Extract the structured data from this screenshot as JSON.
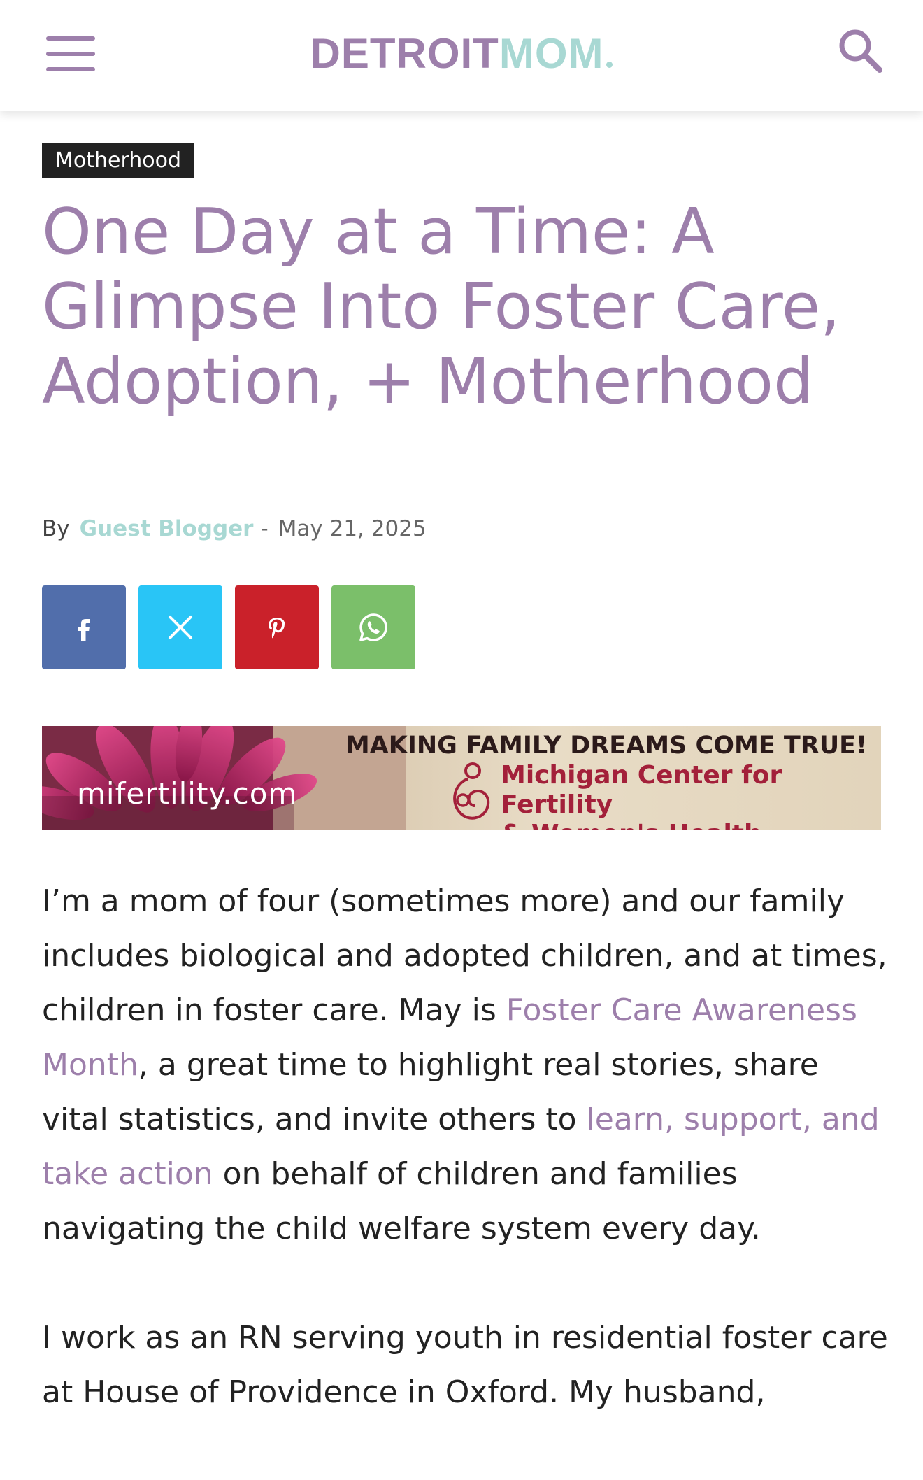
{
  "header": {
    "logo_part1": "DETROIT",
    "logo_part2": "MOM",
    "menu_icon": "hamburger-icon",
    "search_icon": "search-icon"
  },
  "article": {
    "category": "Motherhood",
    "title": "One Day at a Time: A Glimpse Into Foster Care, Adoption, + Motherhood",
    "by_label": "By",
    "author": "Guest Blogger",
    "separator": "-",
    "date": "May 21, 2025"
  },
  "share_buttons": [
    {
      "name": "facebook",
      "icon": "facebook-icon",
      "color": "#516eab"
    },
    {
      "name": "x",
      "icon": "x-icon",
      "color": "#29c5f6"
    },
    {
      "name": "pinterest",
      "icon": "pinterest-icon",
      "color": "#ca212a"
    },
    {
      "name": "whatsapp",
      "icon": "whatsapp-icon",
      "color": "#7bbf6a"
    }
  ],
  "ad_banner": {
    "url_text": "mifertility.com",
    "tagline": "MAKING FAMILY DREAMS COME TRUE!",
    "org_line1": "Michigan Center for Fertility",
    "org_line2": "& Women's Health"
  },
  "body": {
    "p1_a": "I’m a mom of four (sometimes more) and our family includes biological and adopted children, and at times, children in foster care. May is ",
    "p1_link1": "Foster Care Awareness Month",
    "p1_b": ", a great time to highlight real stories, share vital statistics, and invite others to ",
    "p1_link2": "learn, support, and take action",
    "p1_c": " on behalf of children and families navigating the child welfare system every day.",
    "p2": "I work as an RN serving youth in residential foster care at House of Providence in Oxford. My husband,"
  },
  "colors": {
    "brand_purple": "#9d7fab",
    "brand_teal": "#a8d8d3",
    "category_bg": "#222222"
  }
}
